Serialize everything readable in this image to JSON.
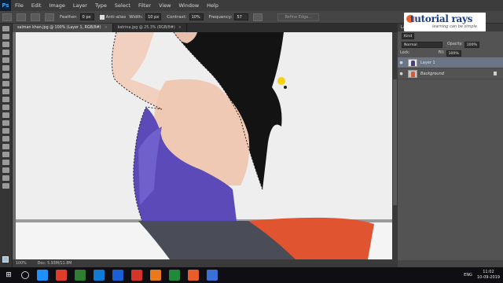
{
  "app": {
    "logo": "Ps"
  },
  "menu": [
    "File",
    "Edit",
    "Image",
    "Layer",
    "Type",
    "Select",
    "Filter",
    "View",
    "Window",
    "Help"
  ],
  "options": {
    "feather_label": "Feather:",
    "feather_value": "0 px",
    "antialias_label": "Anti-alias",
    "width_label": "Width:",
    "width_value": "10 px",
    "contrast_label": "Contrast:",
    "contrast_value": "10%",
    "frequency_label": "Frequency:",
    "frequency_value": "57",
    "refine_label": "Refine Edge..."
  },
  "tabs": [
    {
      "label": "salman khan.jpg @ 100% (Layer 1, RGB/8#)",
      "close": "×"
    },
    {
      "label": "katrina.jpg @ 25.3% (RGB/8#)",
      "close": "×"
    }
  ],
  "status": {
    "zoom": "100%",
    "doc": "Doc: 5.93M/11.8M"
  },
  "layers_panel": {
    "title": "Layers",
    "kind_label": "Kind",
    "blend_mode": "Normal",
    "opacity_label": "Opacity:",
    "opacity_value": "100%",
    "lock_label": "Lock:",
    "fill_label": "Fill:",
    "fill_value": "100%",
    "layers": [
      {
        "name": "Layer 1",
        "selected": true
      },
      {
        "name": "Background",
        "selected": false
      }
    ]
  },
  "watermark": {
    "title": "tutorial rays",
    "subtitle": "learning can be simple"
  },
  "taskbar": {
    "lang": "ENG",
    "time": "11:02",
    "date": "10-09-2019",
    "colors": [
      "#1e90ff",
      "#e03c2c",
      "#2e7d32",
      "#0f7bd4",
      "#1b5fd6",
      "#d3352d",
      "#e97a1b",
      "#1f8a3a",
      "#e85d2a",
      "#3a6fd8"
    ]
  },
  "colors": {
    "panel_bg": "#535353",
    "selection_blue": "#6a7686",
    "tank_top": "#5b4ab8",
    "orange_cushion": "#e0552f"
  }
}
